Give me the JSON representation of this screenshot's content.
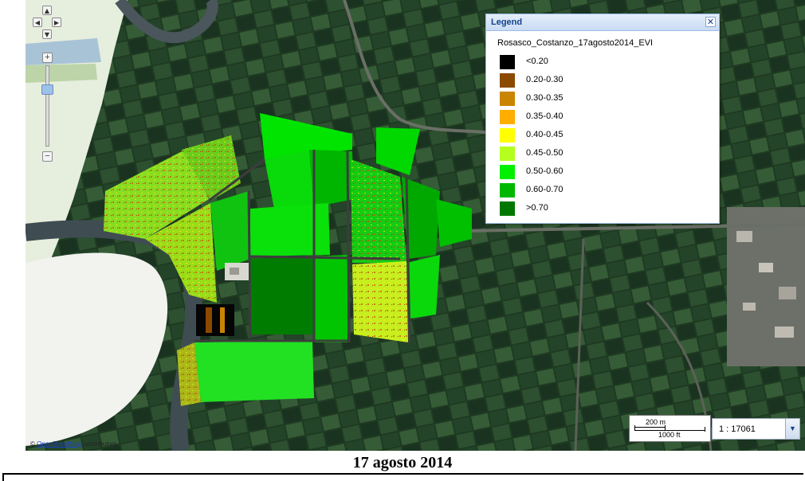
{
  "map": {
    "attribution_prefix": "©",
    "attribution_link": "OpenStreetMap",
    "attribution_suffix": "contributors",
    "nav_icons": {
      "up": "▲",
      "left": "◀",
      "right": "▶",
      "down": "▼"
    },
    "zoom_in": "+",
    "zoom_out": "−"
  },
  "legend": {
    "title": "Legend",
    "close_icon": "✕",
    "layer_name": "Rosasco_Costanzo_17agosto2014_EVI",
    "classes": [
      {
        "label": "<0.20",
        "color": "#000000"
      },
      {
        "label": "0.20-0.30",
        "color": "#8b4a00"
      },
      {
        "label": "0.30-0.35",
        "color": "#c98500"
      },
      {
        "label": "0.35-0.40",
        "color": "#ffae00"
      },
      {
        "label": "0.40-0.45",
        "color": "#ffff00"
      },
      {
        "label": "0.45-0.50",
        "color": "#b4ff1e"
      },
      {
        "label": "0.50-0.60",
        "color": "#00f000"
      },
      {
        "label": "0.60-0.70",
        "color": "#00b800"
      },
      {
        "label": ">0.70",
        "color": "#007800"
      }
    ]
  },
  "scale": {
    "metric": "200 m",
    "imperial": "1000 ft",
    "ratio": "1 : 17061",
    "dropdown_icon": "▼"
  },
  "caption": "17 agosto 2014"
}
